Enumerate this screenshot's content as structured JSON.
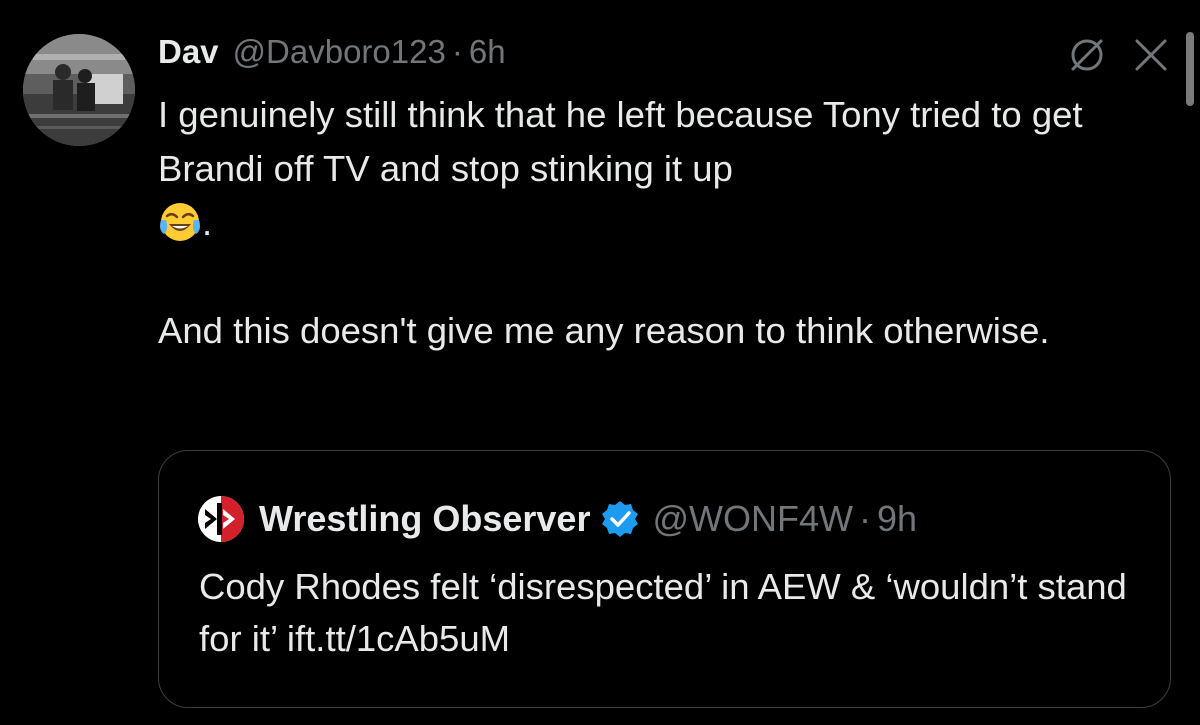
{
  "tweet": {
    "author_name": "Dav",
    "author_handle": "@Davboro123",
    "separator": "·",
    "time": "6h",
    "text_line1": "I genuinely still think that he left because Tony tried to get Brandi off TV and stop stinking it up",
    "text_after_emoji": ".",
    "emoji": "face-with-tears-of-joy",
    "text_para2": "And this doesn't give me any reason to think otherwise."
  },
  "quoted_tweet": {
    "author_name": "Wrestling Observer",
    "author_handle": "@WONF4W",
    "separator": "·",
    "time": "9h",
    "verified": true,
    "text": "Cody Rhodes felt ‘disrespected’ in AEW & ‘wouldn’t stand for it’",
    "link": "ift.tt/1cAb5uM"
  },
  "icons": {
    "top_right": [
      "slashed-circle-icon",
      "close-icon"
    ],
    "verified_color": "#1d9bf0",
    "logo_red": "#d4202a"
  },
  "colors": {
    "background": "#000000",
    "text": "#e7e9ea",
    "secondary": "#71767b",
    "border": "#3a3d41"
  }
}
